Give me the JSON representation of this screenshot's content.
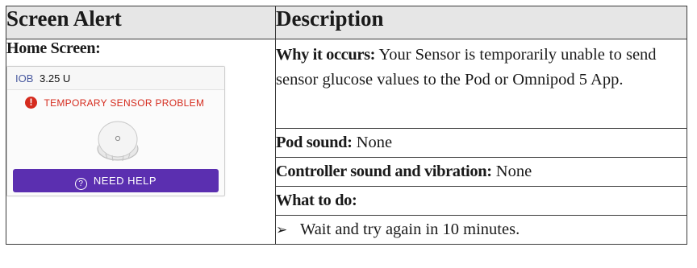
{
  "table": {
    "header_left": "Screen Alert",
    "header_right": "Description"
  },
  "left": {
    "home_label": "Home Screen:",
    "phone": {
      "iob_label": "IOB",
      "iob_value": "3.25 U",
      "alert_icon": "!",
      "alert_text": "TEMPORARY SENSOR PROBLEM",
      "sensor_icon": "sensor-icon",
      "help_icon": "?",
      "help_button": "NEED HELP",
      "colors": {
        "alert": "#d52b1e",
        "button": "#5b2fb0",
        "iob_label": "#4a5aa0"
      }
    }
  },
  "right": {
    "why_label": "Why it occurs:",
    "why_text": "Your Sensor is temporarily unable to send sensor glucose values to the Pod or Omnipod 5 App.",
    "pod_sound_label": "Pod sound:",
    "pod_sound_value": "None",
    "controller_label": "Controller sound and vibration:",
    "controller_value": "None",
    "what_to_do_label": "What to do:",
    "bullet_symbol": "➢",
    "step_1": "Wait and try again in 10 minutes."
  }
}
